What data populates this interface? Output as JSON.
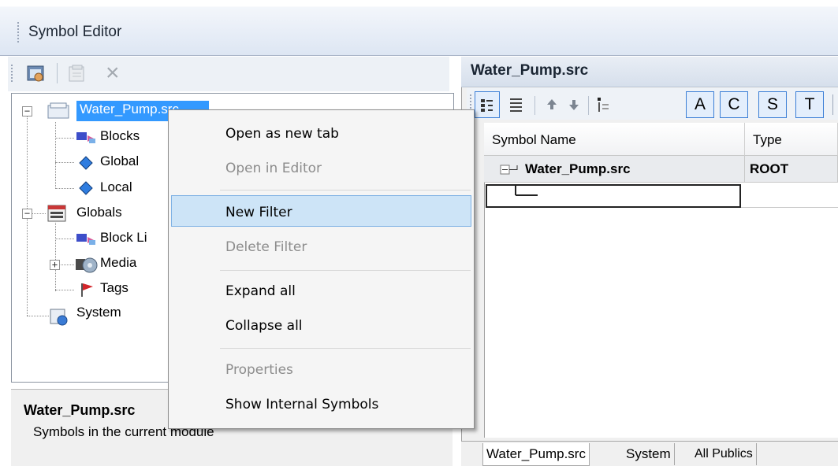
{
  "window": {
    "title": "Symbol Editor"
  },
  "left_toolbar": {
    "close_symbol": "×"
  },
  "tree": {
    "root": "Water_Pump.src",
    "children": [
      "Blocks",
      "Global",
      "Local"
    ],
    "globals": {
      "label": "Globals",
      "children": [
        "Block Li",
        "Media",
        "Tags"
      ]
    },
    "system": "System",
    "expander_minus": "−",
    "expander_plus": "+"
  },
  "description": {
    "title": "Water_Pump.src",
    "text": "Symbols in the current module"
  },
  "right_pane": {
    "header": "Water_Pump.src",
    "toolbar_buttons": [
      "A",
      "C",
      "S",
      "T"
    ],
    "columns": [
      "Symbol Name",
      "Type"
    ],
    "rows": [
      {
        "name": "Water_Pump.src",
        "type": "ROOT"
      }
    ],
    "tabs": [
      "Water_Pump.src",
      "System",
      "All Publics"
    ]
  },
  "context_menu": {
    "items": [
      {
        "label": "Open as new tab",
        "enabled": true
      },
      {
        "label": "Open in Editor",
        "enabled": false
      },
      {
        "label": "New Filter",
        "enabled": true,
        "highlighted": true
      },
      {
        "label": "Delete Filter",
        "enabled": false
      },
      {
        "label": "Expand all",
        "enabled": true
      },
      {
        "label": "Collapse all",
        "enabled": true
      },
      {
        "label": "Properties",
        "enabled": false
      },
      {
        "label": "Show Internal Symbols",
        "enabled": true
      }
    ]
  },
  "colors": {
    "selection": "#3399ff",
    "menu_highlight": "#cde4f7",
    "tab_button_border": "#3c7fd6"
  }
}
